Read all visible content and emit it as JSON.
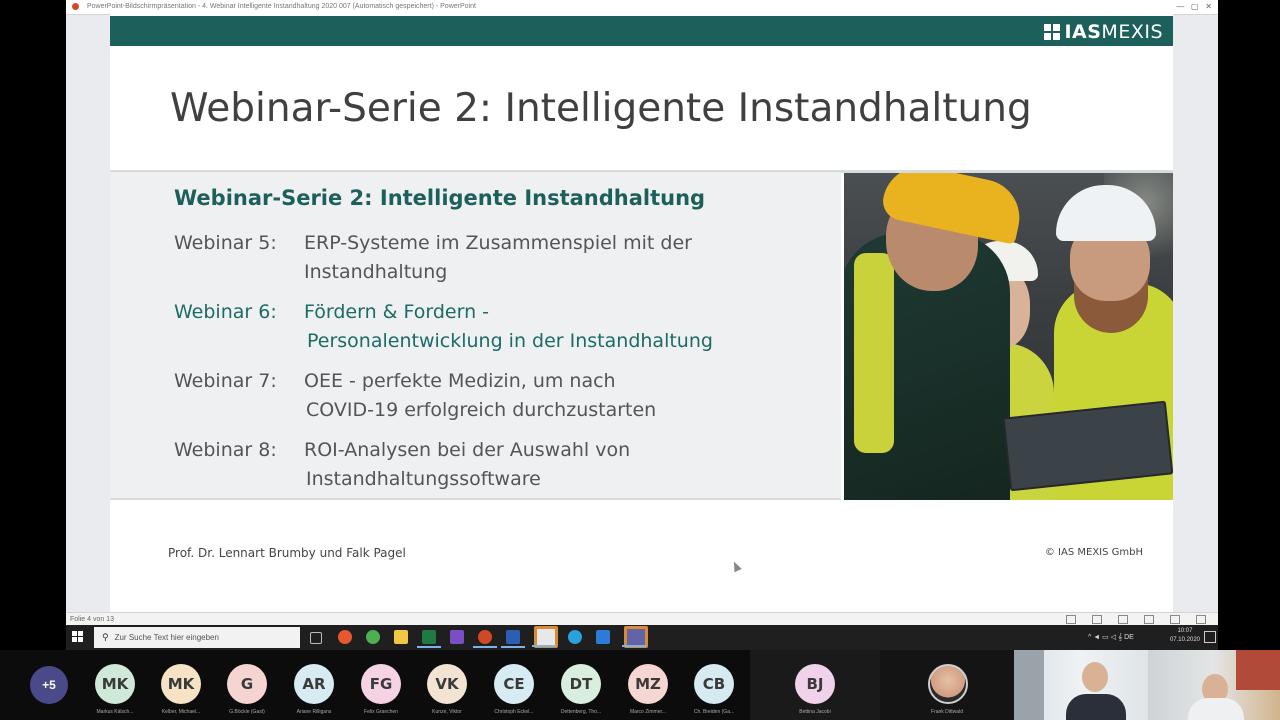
{
  "powerpoint": {
    "window_title": "PowerPoint-Bildschirmpräsentation  -  4. Webinar Intelligente Instandhaltung 2020 007 (Automatisch gespeichert)  -  PowerPoint",
    "status_left": "Folie 4 von 13"
  },
  "slide": {
    "brand_strong": "IAS",
    "brand_light": "MEXIS",
    "title": "Webinar-Serie 2: Intelligente Instandhaltung",
    "heading": "Webinar-Serie 2: Intelligente Instandhaltung",
    "webinars": [
      {
        "label": "Webinar 5:",
        "line1": "ERP-Systeme im Zusammenspiel mit der",
        "line2": "Instandhaltung"
      },
      {
        "label": "Webinar 6:",
        "line1": "Fördern & Fordern  -",
        "line2": "Personalentwicklung in der Instandhaltung"
      },
      {
        "label": "Webinar 7:",
        "line1": "OEE - perfekte Medizin, um nach",
        "line2": "COVID-19 erfolgreich durchzustarten"
      },
      {
        "label": "Webinar 8:",
        "line1": "ROI-Analysen bei der Auswahl von",
        "line2": "Instandhaltungssoftware"
      }
    ],
    "footer_left": "Prof. Dr. Lennart Brumby und Falk Pagel",
    "footer_right": "© IAS MEXIS GmbH",
    "colors": {
      "primary": "#1d5f5a",
      "highlight": "#1d6b66",
      "body_text": "#555555"
    }
  },
  "taskbar": {
    "search_placeholder": "Zur Suche Text hier eingeben",
    "clock_time": "10:07",
    "clock_date": "07.10.2020",
    "tray_text": "^ ◄ ▭ ◁ 𝄞 DE"
  },
  "participants": {
    "more_count": "+5",
    "tiles": [
      {
        "initials": "MK",
        "name": "Markus Kälsch...",
        "color": "#cfe9d8"
      },
      {
        "initials": "MK",
        "name": "Kelber, Michael...",
        "color": "#f6e2c4"
      },
      {
        "initials": "G",
        "name": "G.Böckle (Gast)",
        "color": "#f6d4d1"
      },
      {
        "initials": "AR",
        "name": "Ariane Rilligans",
        "color": "#d6ecf2"
      },
      {
        "initials": "FG",
        "name": "Felix Graechen",
        "color": "#f5d3e4"
      },
      {
        "initials": "VK",
        "name": "Kunze, Viktor",
        "color": "#f3e3d2"
      },
      {
        "initials": "CE",
        "name": "Christoph Eckel...",
        "color": "#d6ecf2"
      },
      {
        "initials": "DT",
        "name": "Dettenberg, Tho...",
        "color": "#d8efe0"
      },
      {
        "initials": "MZ",
        "name": "Marco Zimmer...",
        "color": "#f6d6d3"
      },
      {
        "initials": "CB",
        "name": "Ch. Breiden (Ga...",
        "color": "#d6eaf2"
      }
    ],
    "bj": {
      "initials": "BJ",
      "name": "Bettina Jacobi",
      "color": "#f0d3ea"
    },
    "frank": {
      "name": "Frank Dittwald"
    }
  }
}
